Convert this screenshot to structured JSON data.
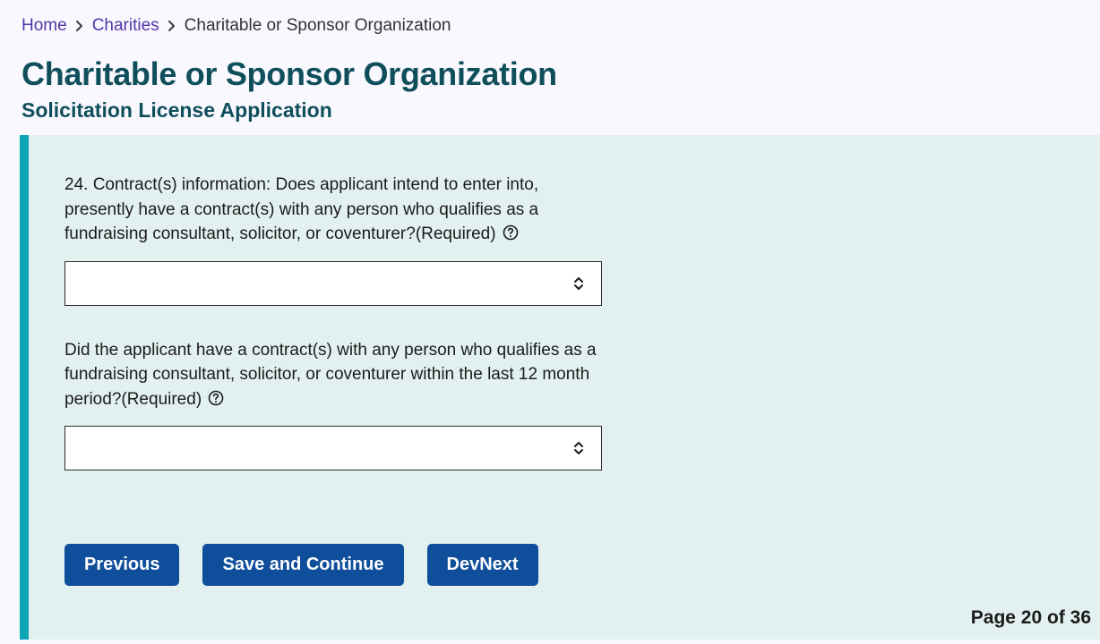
{
  "breadcrumb": {
    "home": "Home",
    "charities": "Charities",
    "current": "Charitable or Sponsor Organization"
  },
  "header": {
    "title": "Charitable or Sponsor Organization",
    "subtitle": "Solicitation License Application"
  },
  "form": {
    "q24": {
      "label": "24. Contract(s) information: Does applicant intend to enter into, presently have a contract(s) with any person who qualifies as a fundraising consultant, solicitor, or coventurer?(Required)",
      "value": ""
    },
    "q24b": {
      "label": "Did the applicant have a contract(s) with any person who qualifies as a fundraising consultant, solicitor, or coventurer within the last 12 month period?(Required)",
      "value": ""
    }
  },
  "actions": {
    "previous": "Previous",
    "save_continue": "Save and Continue",
    "devnext": "DevNext"
  },
  "pager": {
    "label": "Page 20 of 36"
  }
}
